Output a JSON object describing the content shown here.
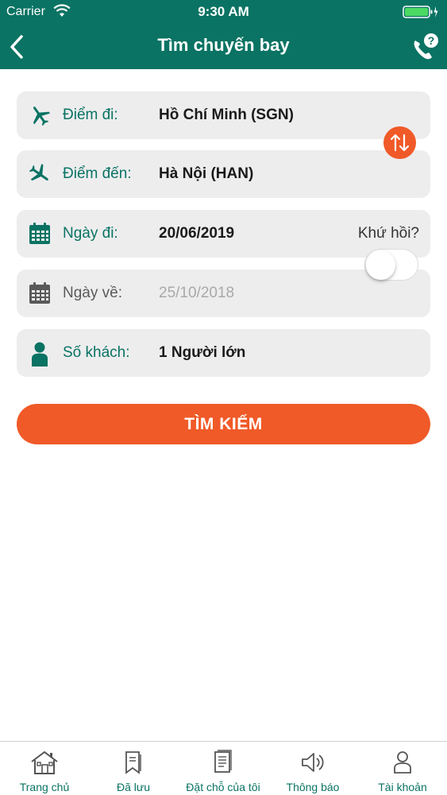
{
  "status_bar": {
    "carrier": "Carrier",
    "time": "9:30 AM"
  },
  "header": {
    "title": "Tìm chuyến bay"
  },
  "form": {
    "from": {
      "label": "Điểm đi:",
      "value": "Hồ Chí Minh (SGN)",
      "icon": "plane-takeoff-icon"
    },
    "to": {
      "label": "Điểm đến:",
      "value": "Hà Nội (HAN)",
      "icon": "plane-landing-icon"
    },
    "depart": {
      "label": "Ngày đi:",
      "value": "20/06/2019",
      "icon": "calendar-icon"
    },
    "round_trip": {
      "label": "Khứ hồi?",
      "enabled": false
    },
    "return": {
      "label": "Ngày về:",
      "value": "25/10/2018",
      "icon": "calendar-icon"
    },
    "passengers": {
      "label": "Số khách:",
      "value": "1 Người lớn",
      "icon": "person-icon"
    }
  },
  "search_button": {
    "label": "TÌM KIẾM"
  },
  "tabs": [
    {
      "label": "Trang chủ",
      "icon": "home-icon"
    },
    {
      "label": "Đã lưu",
      "icon": "bookmark-icon"
    },
    {
      "label": "Đặt chỗ của tôi",
      "icon": "document-icon"
    },
    {
      "label": "Thông báo",
      "icon": "speaker-icon"
    },
    {
      "label": "Tài khoản",
      "icon": "user-icon"
    }
  ],
  "colors": {
    "primary": "#0a7363",
    "accent": "#f05a28",
    "field_bg": "#ededee"
  }
}
